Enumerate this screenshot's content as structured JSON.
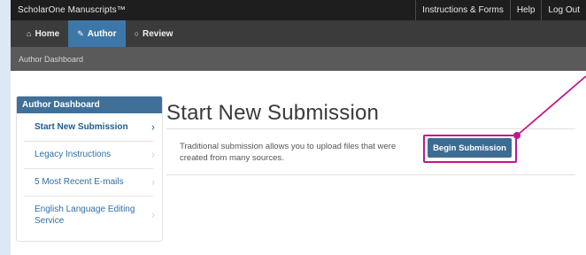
{
  "topbar": {
    "brand": "ScholarOne Manuscripts™",
    "links": [
      "Instructions & Forms",
      "Help",
      "Log Out"
    ]
  },
  "nav": {
    "tabs": [
      {
        "label": "Home",
        "icon": "home-icon",
        "icon_glyph": "⌂"
      },
      {
        "label": "Author",
        "icon": "pencil-icon",
        "icon_glyph": "✎"
      },
      {
        "label": "Review",
        "icon": "speech-bubble-icon",
        "icon_glyph": "○"
      }
    ],
    "active_tab": "Author"
  },
  "subnav": {
    "label": "Author Dashboard"
  },
  "sidebar": {
    "header": "Author Dashboard",
    "items": [
      {
        "label": "Start New Submission",
        "active": true
      },
      {
        "label": "Legacy Instructions"
      },
      {
        "label": "5 Most Recent E-mails"
      },
      {
        "label": "English Language Editing Service"
      }
    ],
    "chevron": "›"
  },
  "main": {
    "title": "Start New Submission",
    "description": "Traditional submission allows you to upload files that were created from many sources.",
    "button": "Begin Submission"
  },
  "colors": {
    "highlight": "#c0188c",
    "primary": "#3d6c93",
    "link": "#2e6fa6",
    "active_tab": "#3d77a8"
  }
}
